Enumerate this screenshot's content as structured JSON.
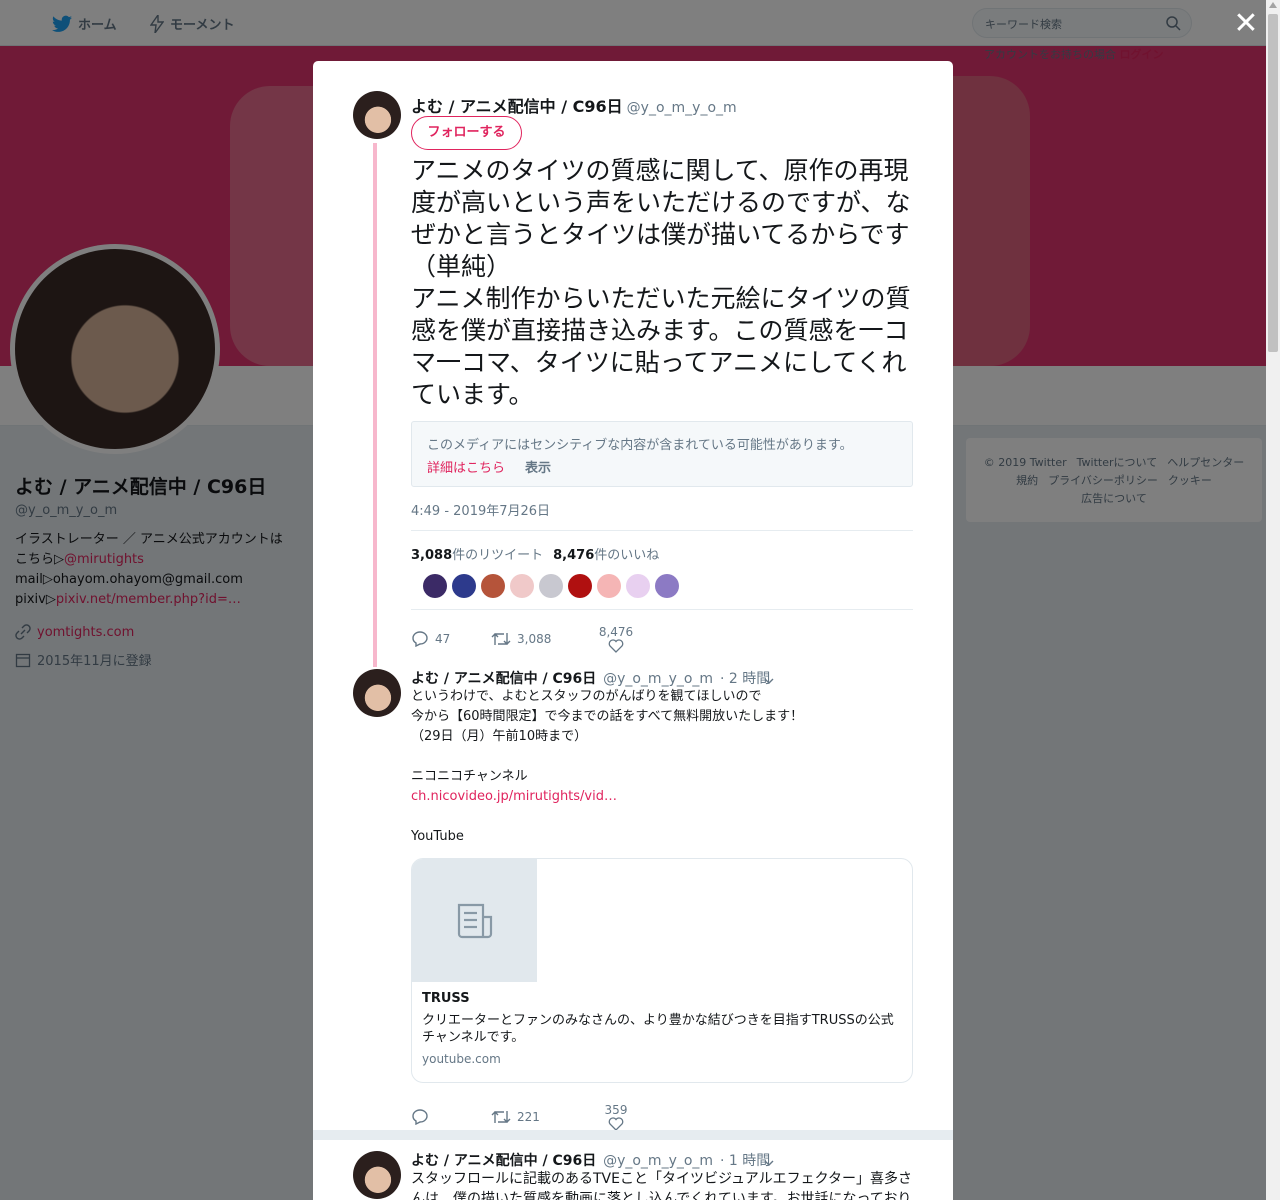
{
  "nav": {
    "home": "ホーム",
    "moments": "モーメント",
    "search_placeholder": "キーワード検索",
    "login_prompt": "アカウントをお持ちの場合",
    "login": "ログイン"
  },
  "profile": {
    "name": "よむ / アニメ配信中 / C96日",
    "handle": "@y_o_m_y_o_m",
    "bio_line1": "イラストレーター ／ アニメ公式アカウントはこちら▷",
    "bio_link1": "@mirutights",
    "bio_line2": "mail▷ohayom.ohayom@gmail.com",
    "bio_line3": "pixiv▷",
    "bio_link3": "pixiv.net/member.php?id=…",
    "website": "yomtights.com",
    "joined": "2015年11月に登録"
  },
  "footer": {
    "links": [
      "© 2019 Twitter",
      "Twitterについて",
      "ヘルプセンター",
      "規約",
      "プライバシーポリシー",
      "クッキー",
      "広告について"
    ]
  },
  "modal": {
    "main_tweet": {
      "name": "よむ / アニメ配信中 / C96日",
      "handle": "@y_o_m_y_o_m",
      "follow": "フォローする",
      "text": "アニメのタイツの質感に関して、原作の再現度が高いという声をいただけるのですが、なぜかと言うとタイツは僕が描いてるからです（単純）\nアニメ制作からいただいた元絵にタイツの質感を僕が直接描き込みます。この質感を一コマ一コマ、タイツに貼ってアニメにしてくれています。",
      "sensitive_notice": "このメディアにはセンシティブな内容が含まれている可能性があります。",
      "sensitive_more": "詳細はこちら",
      "sensitive_show": "表示",
      "timestamp": "4:49 - 2019年7月26日",
      "retweets_count": "3,088",
      "retweets_label": "件のリツイート",
      "likes_count": "8,476",
      "likes_label": "件のいいね",
      "reply_count": "47",
      "retweet_count": "3,088",
      "like_count": "8,476",
      "liker_colors": [
        "#3b2a66",
        "#2d3a8c",
        "#b5543a",
        "#f0c9c9",
        "#c8c8d0",
        "#b01010",
        "#f5b5b5",
        "#e8d0f0",
        "#8c7ac4"
      ]
    },
    "reply1": {
      "name": "よむ / アニメ配信中 / C96日",
      "handle": "@y_o_m_y_o_m",
      "time": "· 2 時間",
      "text": "というわけで、よむとスタッフのがんばりを観てほしいので\n今から【60時間限定】で今までの話をすべて無料開放いたします！\n（29日（月）午前10時まで）\n\nニコニコチャンネル",
      "link": "ch.nicovideo.jp/mirutights/vid…",
      "youtube": "YouTube",
      "card_title": "TRUSS",
      "card_desc": "クリエーターとファンのみなさんの、より豊かな結びつきを目指すTRUSSの公式チャンネルです。",
      "card_domain": "youtube.com",
      "retweet_count": "221",
      "like_count": "359"
    },
    "reply2": {
      "name": "よむ / アニメ配信中 / C96日",
      "handle": "@y_o_m_y_o_m",
      "time": "· 1 時間",
      "text": "スタッフロールに記載のあるTVEこと「タイツビジュアルエフェクター」喜多さんは、僕の描いた質感を動画に落とし込んでくれています。お世話になっております"
    }
  }
}
